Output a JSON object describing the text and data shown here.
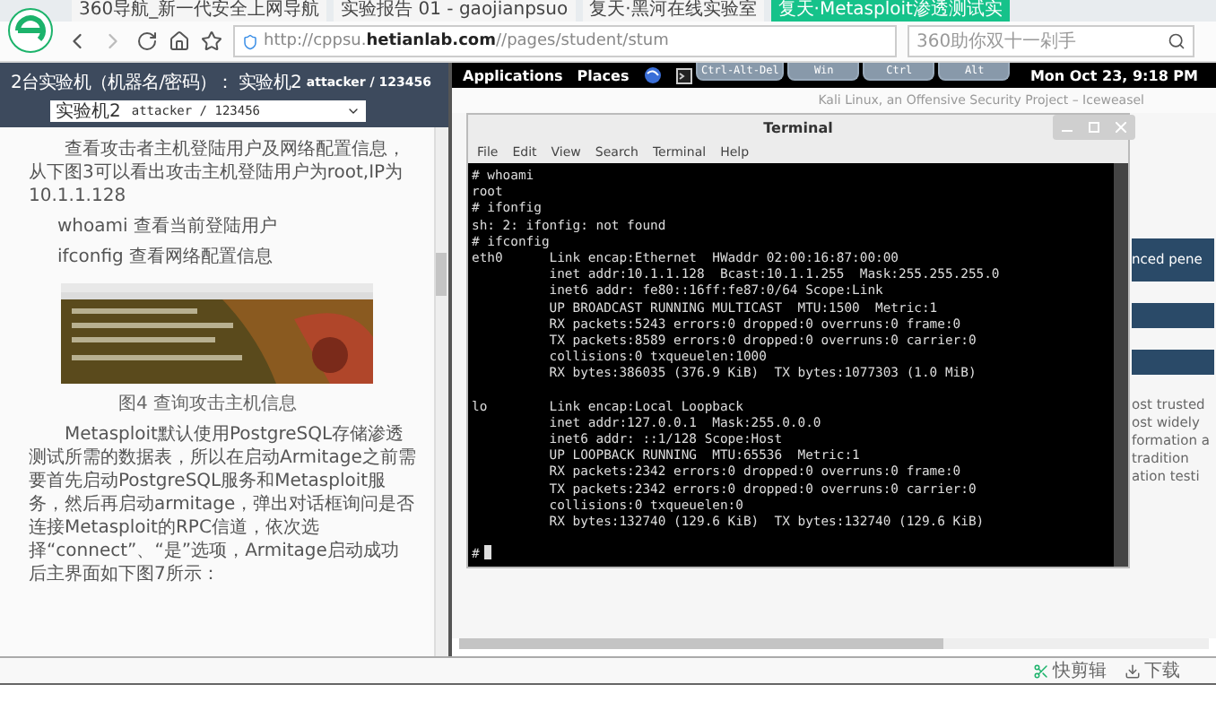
{
  "browser": {
    "tabs": [
      {
        "label": "360导航_新一代安全上网导航",
        "selected": false
      },
      {
        "label": "实验报告 01 - gaojianpsuo",
        "selected": false
      },
      {
        "label": "复天·黑河在线实验室",
        "selected": false
      },
      {
        "label": "复天·Metasploit渗透测试实",
        "selected": true
      }
    ],
    "address": "http://cppsu.**hetianlab.com**//pages/student/stum",
    "search_placeholder": "360助你双十一剁手"
  },
  "lab_panel": {
    "title": "2台实验机（机器名/密码）：",
    "machine": "实验机2",
    "credentials": "attacker / 123456",
    "dropdown": {
      "machine": "实验机2",
      "credentials": "attacker / 123456"
    },
    "paragraphs": [
      "查看攻击者主机登陆用户及网络配置信息，从下图3可以看出攻击主机登陆用户为root,IP为10.1.1.128",
      "whoami 查看当前登陆用户",
      "ifconfig 查看网络配置信息"
    ],
    "figure": {
      "kind": "picture"
    },
    "caption": "图4 查询攻击主机信息",
    "body": "Metasploit默认使用PostgreSQL存储渗透测试所需的数据表，所以在启动Armitage之前需要首先启动PostgreSQL服务和Metasploit服务，然后再启动armitage，弹出对话框询问是否连接Metasploit的RPC信道，依次选择“connect”、“是”选项，Armitage启动成功后主界面如下图7所示："
  },
  "remote": {
    "panel": {
      "menus": [
        "Applications",
        "Places"
      ],
      "clock": "Mon Oct 23,  9:18 PM"
    },
    "keys": [
      "Ctrl-Alt-Del",
      "Win",
      "Ctrl",
      "Alt"
    ],
    "browser_title": "Kali Linux, an Offensive Security Project – Iceweasel",
    "page_fragments": [
      {
        "kind": "band",
        "text": "nced pene"
      },
      {
        "kind": "band"
      },
      {
        "kind": "band"
      },
      {
        "kind": "text",
        "text": "ost trusted"
      },
      {
        "kind": "text",
        "text": "ost widely"
      },
      {
        "kind": "text",
        "text": "formation a"
      },
      {
        "kind": "text",
        "text": "tradition"
      },
      {
        "kind": "text",
        "text": "ation testi"
      }
    ],
    "terminal": {
      "title": "Terminal",
      "menus": [
        "File",
        "Edit",
        "View",
        "Search",
        "Terminal",
        "Help"
      ],
      "blocks": [
        [
          "# whoami",
          "root",
          "# ifonfig",
          "sh: 2: ifonfig: not found",
          "# ifconfig",
          "eth0      Link encap:Ethernet  HWaddr 02:00:16:87:00:00",
          "          inet addr:10.1.1.128  Bcast:10.1.1.255  Mask:255.255.255.0",
          "          inet6 addr: fe80::16ff:fe87:0/64 Scope:Link",
          "          UP BROADCAST RUNNING MULTICAST  MTU:1500  Metric:1",
          "          RX packets:5243 errors:0 dropped:0 overruns:0 frame:0",
          "          TX packets:8589 errors:0 dropped:0 overruns:0 carrier:0",
          "          collisions:0 txqueuelen:1000",
          "          RX bytes:386035 (376.9 KiB)  TX bytes:1077303 (1.0 MiB)"
        ],
        [
          "lo        Link encap:Local Loopback",
          "          inet addr:127.0.0.1  Mask:255.0.0.0",
          "          inet6 addr: ::1/128 Scope:Host",
          "          UP LOOPBACK RUNNING  MTU:65536  Metric:1",
          "          RX packets:2342 errors:0 dropped:0 overruns:0 frame:0",
          "          TX packets:2342 errors:0 dropped:0 overruns:0 carrier:0",
          "          collisions:0 txqueuelen:0",
          "          RX bytes:132740 (129.6 KiB)  TX bytes:132740 (129.6 KiB)"
        ],
        [
          "#"
        ]
      ]
    }
  },
  "status_bar": {
    "items": [
      "快剪辑",
      "下载"
    ]
  }
}
